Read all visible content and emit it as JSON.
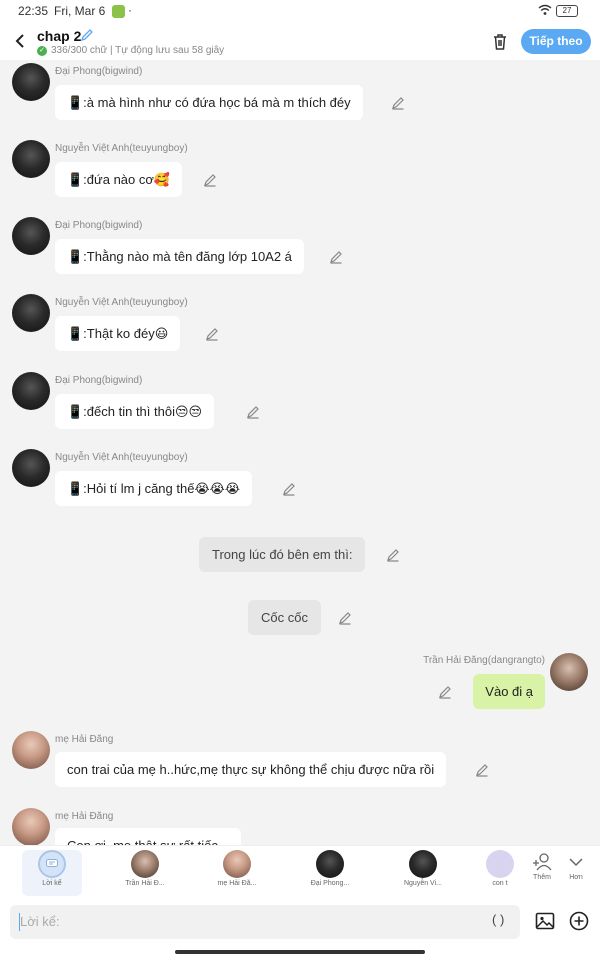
{
  "status_bar": {
    "time": "22:35",
    "date": "Fri, Mar 6",
    "dot": "·",
    "battery": "27"
  },
  "header": {
    "title": "chap 2",
    "subtitle": "336/300 chữ | Tự động lưu sau 58 giây",
    "next_label": "Tiếp theo",
    "check_glyph": "✓"
  },
  "messages": [
    {
      "sender": "Đại Phong(bigwind)",
      "text": "📱:à mà hình như có đứa học bá mà m thích đéy"
    },
    {
      "sender": "Nguyễn Việt Anh(teuyungboy)",
      "text": "📱:đứa nào cơ🥰"
    },
    {
      "sender": "Đại Phong(bigwind)",
      "text": "📱:Thằng nào mà tên đăng lớp 10A2 á"
    },
    {
      "sender": "Nguyễn Việt Anh(teuyungboy)",
      "text": "📱:Thật ko đéy😃"
    },
    {
      "sender": "Đại Phong(bigwind)",
      "text": "📱:đếch tin thì thôi😒😒"
    },
    {
      "sender": "Nguyễn Việt Anh(teuyungboy)",
      "text": "📱:Hỏi tí lm j căng thế😭😭😭"
    }
  ],
  "narrations": [
    "Trong lúc đó bên em thì:",
    "Cốc cốc"
  ],
  "my_message": {
    "sender": "Trần Hải Đăng(dangrangto)",
    "text": "Vào đi ạ"
  },
  "mom_messages": [
    {
      "sender": "mẹ Hải Đăng",
      "text": "con trai của mẹ h..hức,mẹ thực sự không thể chịu được nữa rồi"
    },
    {
      "sender": "mẹ Hải Đăng",
      "text": "Con ơi, mẹ thật sự rất tiếc..."
    }
  ],
  "characters": [
    {
      "label": "Lời kể"
    },
    {
      "label": "Trần Hải Đ..."
    },
    {
      "label": "mẹ Hải Đă..."
    },
    {
      "label": "Đại Phong..."
    },
    {
      "label": "Nguyễn Vi..."
    },
    {
      "label": "con t"
    }
  ],
  "char_bar_actions": {
    "add_label": "Thêm",
    "more_label": "Hơn"
  },
  "composer": {
    "placeholder": "Lời kể:",
    "paren_label": "( )"
  }
}
